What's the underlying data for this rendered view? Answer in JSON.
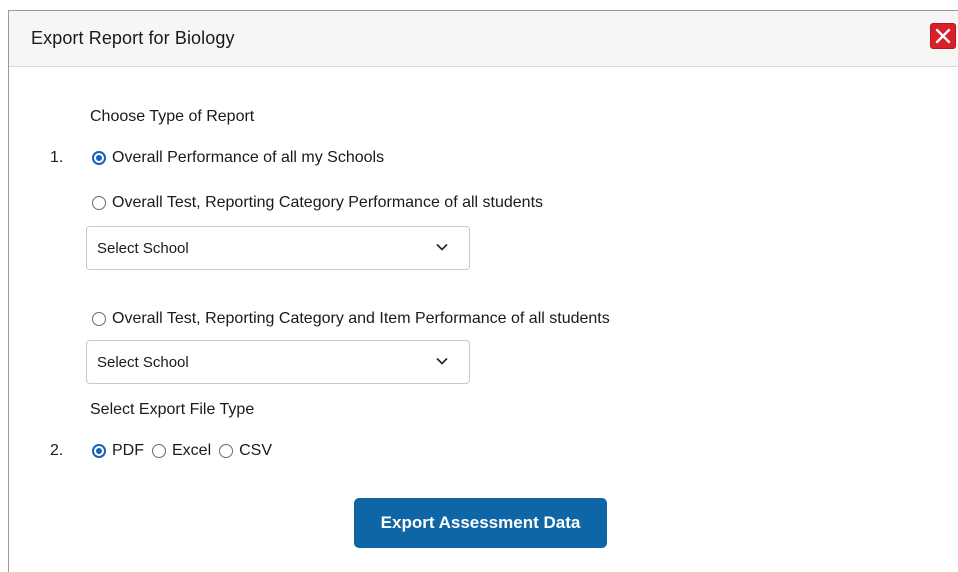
{
  "dialog": {
    "title": "Export Report for Biology",
    "close_icon": "close-x-icon",
    "accent_color": "#0f66a7",
    "close_color": "#d8202a"
  },
  "report_type": {
    "heading": "Choose Type of Report",
    "number": "1.",
    "options": [
      {
        "label": "Overall Performance of all my Schools",
        "checked": true
      },
      {
        "label": "Overall Test, Reporting Category Performance of all students",
        "checked": false
      },
      {
        "label": "Overall Test, Reporting Category and Item Performance of all students",
        "checked": false
      }
    ],
    "school_selects": [
      {
        "value": "Select School"
      },
      {
        "value": "Select School"
      }
    ]
  },
  "file_type": {
    "heading": "Select Export File Type",
    "number": "2.",
    "options": [
      {
        "label": "PDF",
        "checked": true
      },
      {
        "label": "Excel",
        "checked": false
      },
      {
        "label": "CSV",
        "checked": false
      }
    ]
  },
  "actions": {
    "export_label": "Export Assessment Data"
  }
}
